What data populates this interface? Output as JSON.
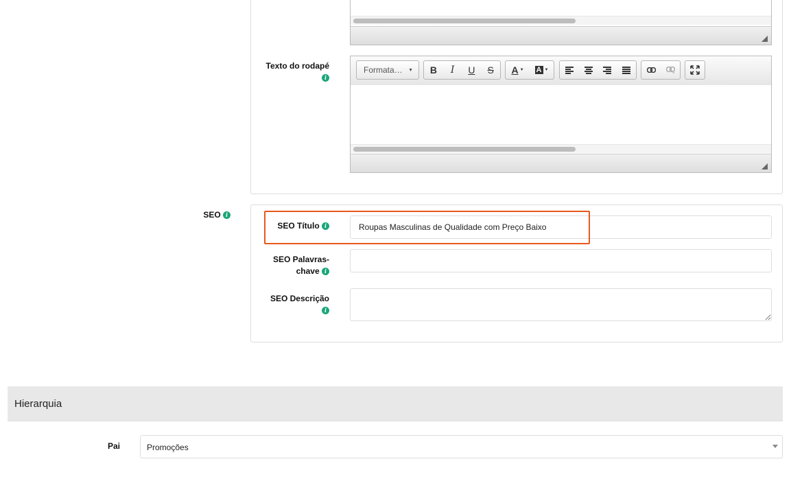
{
  "editor_footer": {
    "label": "Texto do rodapé",
    "format_dropdown": "Formata…",
    "buttons": {
      "bold": "B",
      "italic": "I",
      "underline": "U",
      "strike": "S",
      "text_color": "A",
      "bg_color": "A"
    }
  },
  "seo": {
    "section_label": "SEO",
    "title_label": "SEO Título",
    "title_value": "Roupas Masculinas de Qualidade com Preço Baixo",
    "keywords_label_line1": "SEO Palavras-",
    "keywords_label_line2": "chave",
    "keywords_value": "",
    "description_label": "SEO Descrição",
    "description_value": ""
  },
  "hierarchy": {
    "title": "Hierarquia",
    "parent_label": "Pai",
    "parent_value": "Promoções"
  },
  "colors": {
    "info_icon": "#1aa67a",
    "highlight_border": "#e8581c",
    "section_header_bg": "#e8e8e8"
  },
  "icons": [
    "info-icon",
    "bold-icon",
    "italic-icon",
    "underline-icon",
    "strikethrough-icon",
    "text-color-icon",
    "background-color-icon",
    "align-left-icon",
    "align-center-icon",
    "align-right-icon",
    "align-justify-icon",
    "link-icon",
    "unlink-icon",
    "maximize-icon",
    "resize-grip-icon",
    "chevron-down-icon"
  ]
}
